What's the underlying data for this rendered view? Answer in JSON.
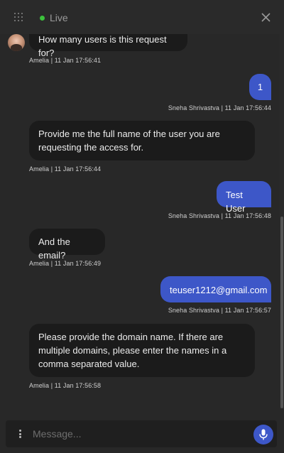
{
  "header": {
    "status_label": "Live",
    "status_color": "#3cc23c",
    "menu_icon": "grid-icon",
    "close_icon": "close-icon"
  },
  "messages": [
    {
      "from": "bot",
      "text": "How many users is this request for?",
      "meta": "Amelia | 11 Jan 17:56:41"
    },
    {
      "from": "user",
      "text": "1",
      "meta": "Sneha Shrivastva | 11 Jan 17:56:44"
    },
    {
      "from": "bot",
      "text": "Provide me the full name of the user you are requesting the access for.",
      "meta": "Amelia | 11 Jan 17:56:44"
    },
    {
      "from": "user",
      "text": "Test User",
      "meta": "Sneha Shrivastva | 11 Jan 17:56:48"
    },
    {
      "from": "bot",
      "text": "And the email?",
      "meta": "Amelia | 11 Jan 17:56:49"
    },
    {
      "from": "user",
      "text": "teuser1212@gmail.com",
      "meta": "Sneha Shrivastva | 11 Jan 17:56:57"
    },
    {
      "from": "bot",
      "text": "Please provide the domain name. If there are multiple domains, please enter the names in a comma separated value.",
      "meta": "Amelia | 11 Jan 17:56:58"
    }
  ],
  "composer": {
    "placeholder": "Message...",
    "more_icon": "more-vertical-icon",
    "mic_icon": "microphone-icon"
  },
  "colors": {
    "background": "#282828",
    "bot_bubble": "#1b1b1b",
    "user_bubble": "#3d57c8"
  }
}
